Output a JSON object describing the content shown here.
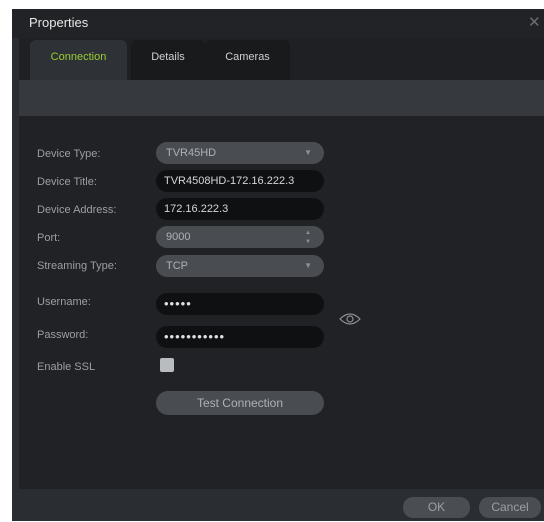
{
  "window": {
    "title": "Properties"
  },
  "tabs": [
    {
      "label": "Connection",
      "active": true
    },
    {
      "label": "Details",
      "active": false
    },
    {
      "label": "Cameras",
      "active": false
    }
  ],
  "form": {
    "device_type": {
      "label": "Device Type:",
      "value": "TVR45HD"
    },
    "device_title": {
      "label": "Device Title:",
      "value": "TVR4508HD-172.16.222.3"
    },
    "device_address": {
      "label": "Device Address:",
      "value": "172.16.222.3"
    },
    "port": {
      "label": "Port:",
      "value": "9000"
    },
    "streaming_type": {
      "label": "Streaming Type:",
      "value": "TCP"
    },
    "username": {
      "label": "Username:",
      "value": "•••••"
    },
    "password": {
      "label": "Password:",
      "value": "•••••••••••"
    },
    "enable_ssl": {
      "label": "Enable SSL",
      "checked": false
    },
    "test_connection_label": "Test Connection"
  },
  "footer": {
    "ok_label": "OK",
    "cancel_label": "Cancel"
  },
  "icons": {
    "close": "close-icon",
    "dropdown": "chevron-down-icon",
    "spinner": "spinner-arrows-icon",
    "show_password": "eye-icon"
  },
  "colors": {
    "active_tab_text": "#9acd32",
    "window_bg": "#2a2d31",
    "content_bg": "#202225",
    "field_bg": "#0f1012",
    "combo_bg": "#494d52"
  }
}
